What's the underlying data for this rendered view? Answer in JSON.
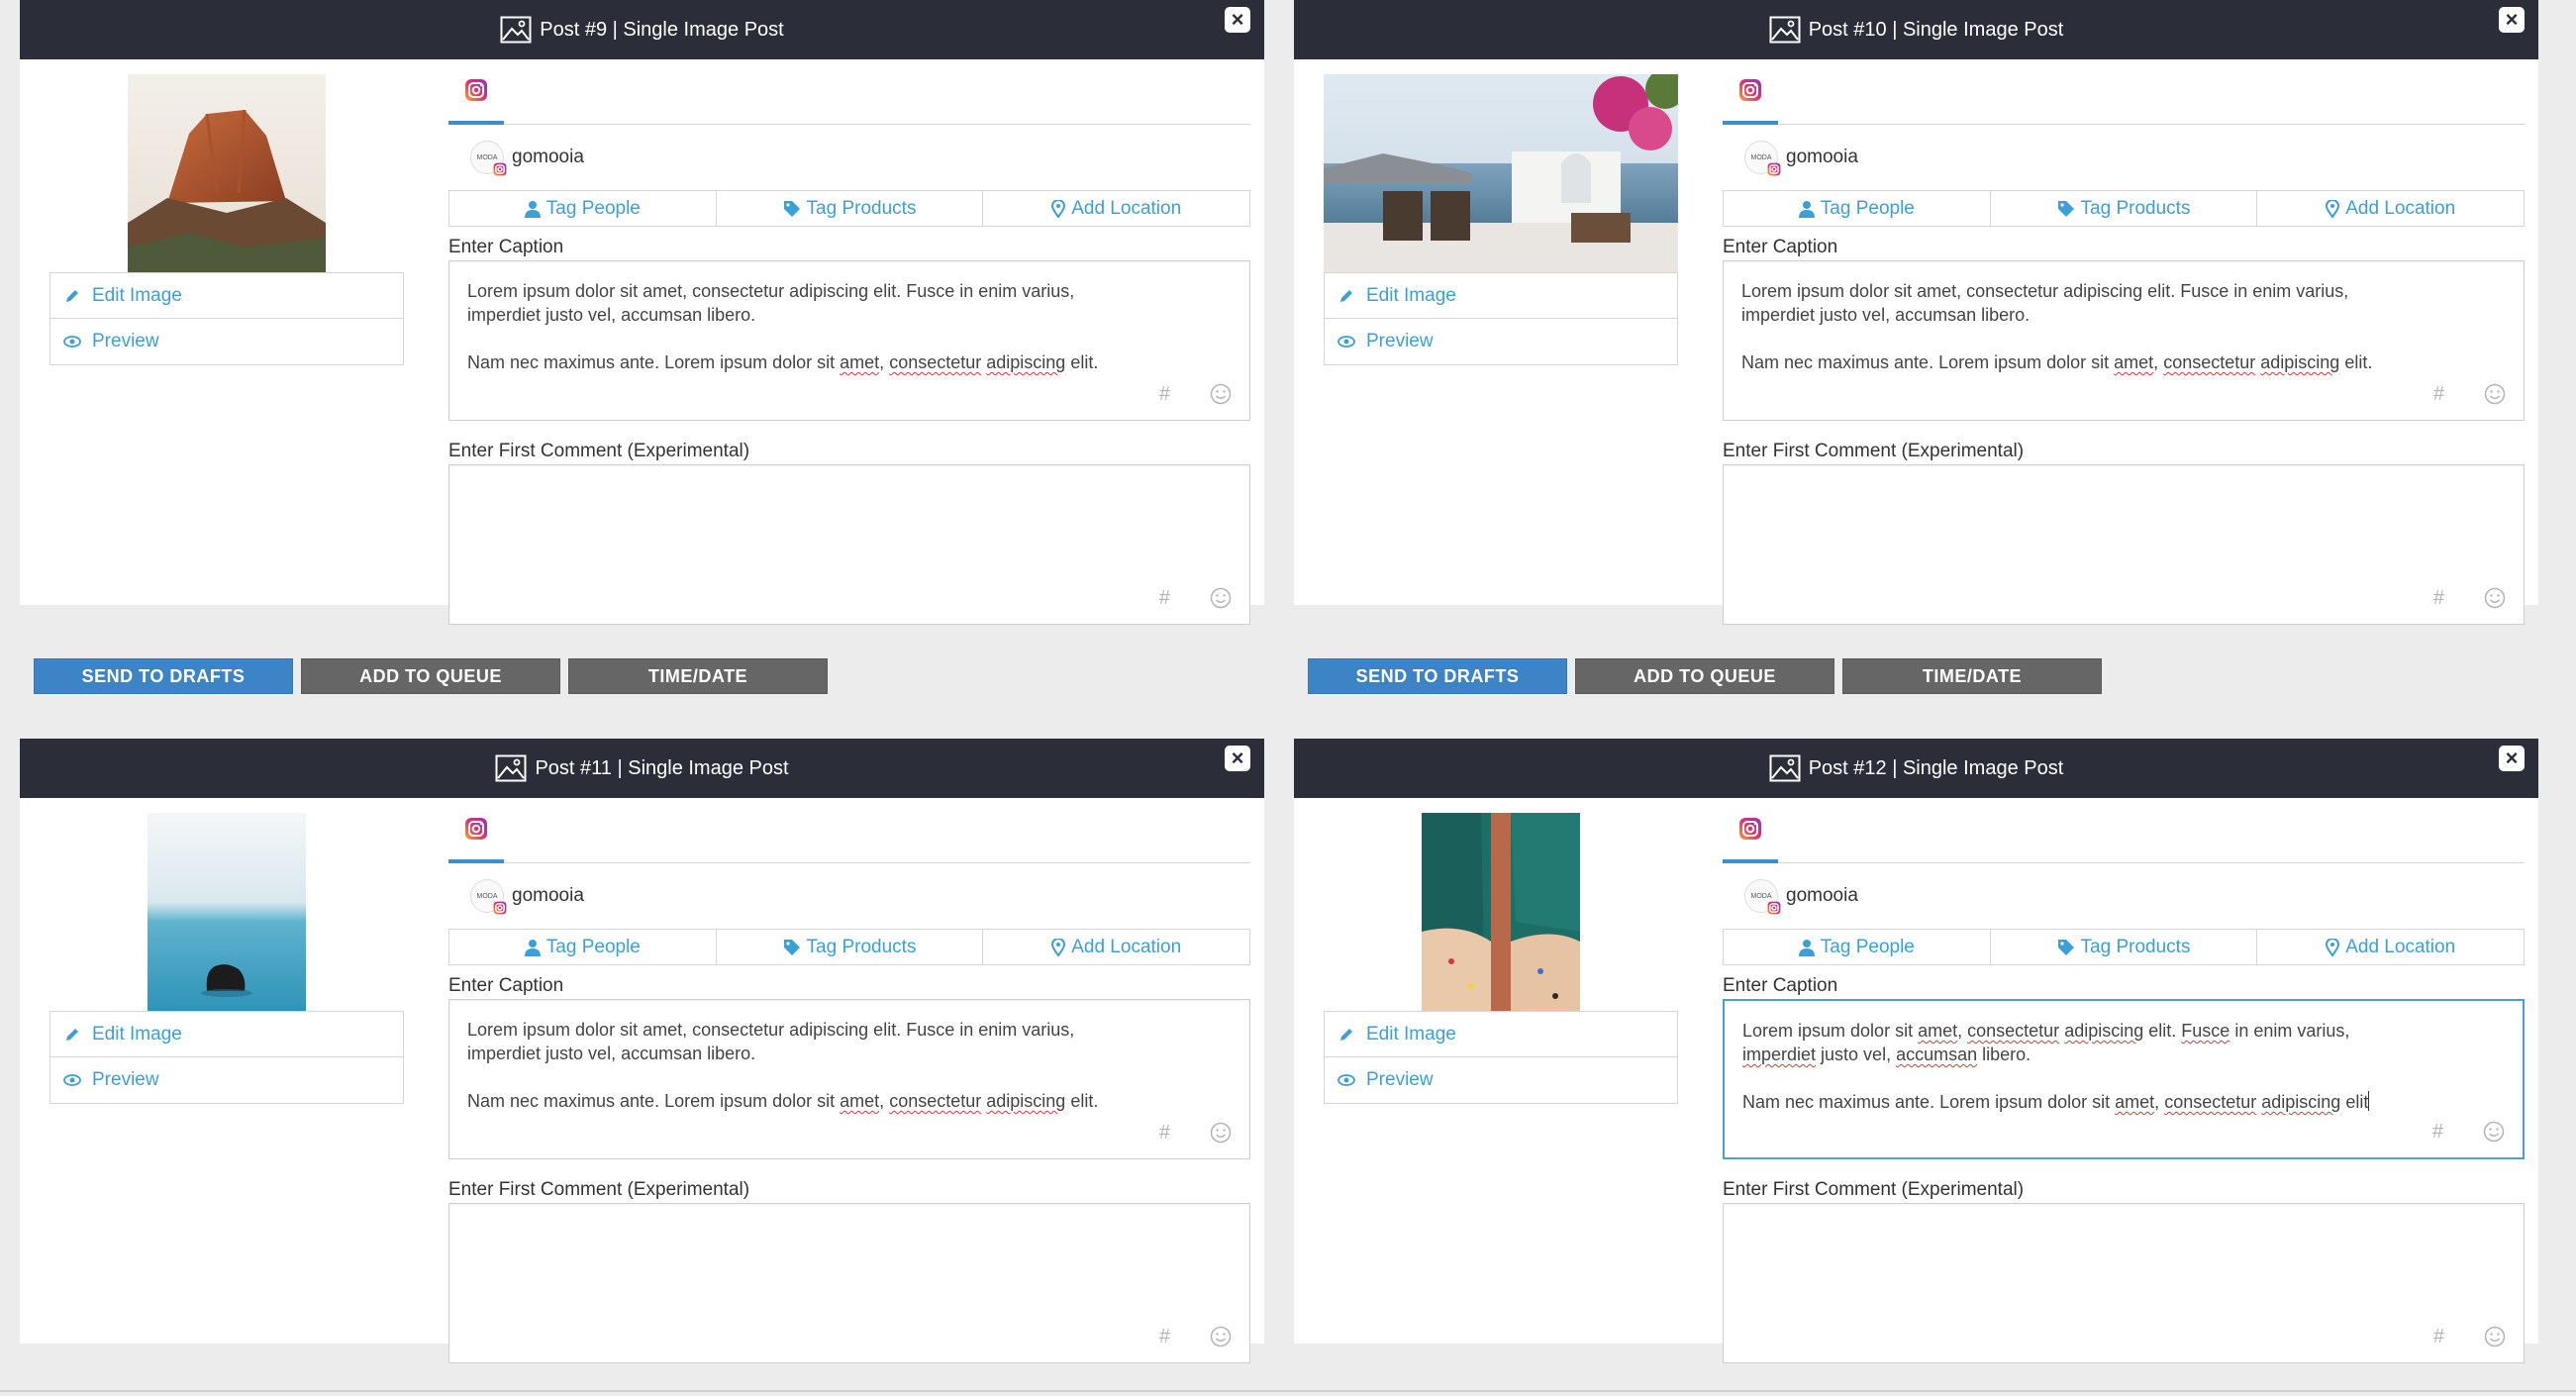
{
  "posts": [
    {
      "title": "Post #9 | Single Image Post",
      "account": "gomooia",
      "avatar_text": "MODA",
      "tags": {
        "people": "Tag People",
        "products": "Tag Products",
        "location": "Add Location"
      },
      "caption_label": "Enter Caption",
      "caption_line1": "Lorem ipsum dolor sit amet, consectetur adipiscing elit. Fusce in enim varius,",
      "caption_line2": "imperdiet justo vel, accumsan libero.",
      "caption_line3_a": "Nam nec maximus ante. Lorem ipsum dolor sit ",
      "caption_line3_b": "amet",
      "caption_line3_c": ", ",
      "caption_line3_d": "consectetur",
      "caption_line3_e": " ",
      "caption_line3_f": "adipiscing",
      "caption_line3_g": " elit.",
      "comment_label": "Enter First Comment (Experimental)",
      "edit_label": "Edit Image",
      "preview_label": "Preview",
      "hash": "#"
    },
    {
      "title": "Post #10 | Single Image Post",
      "account": "gomooia",
      "avatar_text": "MODA",
      "tags": {
        "people": "Tag People",
        "products": "Tag Products",
        "location": "Add Location"
      },
      "caption_label": "Enter Caption",
      "caption_line1": "Lorem ipsum dolor sit amet, consectetur adipiscing elit. Fusce in enim varius,",
      "caption_line2": "imperdiet justo vel, accumsan libero.",
      "caption_line3_a": "Nam nec maximus ante. Lorem ipsum dolor sit ",
      "caption_line3_b": "amet",
      "caption_line3_c": ", ",
      "caption_line3_d": "consectetur",
      "caption_line3_e": " ",
      "caption_line3_f": "adipiscing",
      "caption_line3_g": " elit.",
      "comment_label": "Enter First Comment (Experimental)",
      "edit_label": "Edit Image",
      "preview_label": "Preview",
      "hash": "#"
    },
    {
      "title": "Post #11 | Single Image Post",
      "account": "gomooia",
      "avatar_text": "MODA",
      "tags": {
        "people": "Tag People",
        "products": "Tag Products",
        "location": "Add Location"
      },
      "caption_label": "Enter Caption",
      "caption_line1": "Lorem ipsum dolor sit amet, consectetur adipiscing elit. Fusce in enim varius,",
      "caption_line2": "imperdiet justo vel, accumsan libero.",
      "caption_line3_a": "Nam nec maximus ante. Lorem ipsum dolor sit ",
      "caption_line3_b": "amet",
      "caption_line3_c": ", ",
      "caption_line3_d": "consectetur",
      "caption_line3_e": " ",
      "caption_line3_f": "adipiscing",
      "caption_line3_g": " elit.",
      "comment_label": "Enter First Comment (Experimental)",
      "edit_label": "Edit Image",
      "preview_label": "Preview",
      "hash": "#"
    },
    {
      "title": "Post #12 | Single Image Post",
      "account": "gomooia",
      "avatar_text": "MODA",
      "tags": {
        "people": "Tag People",
        "products": "Tag Products",
        "location": "Add Location"
      },
      "caption_label": "Enter Caption",
      "c12": {
        "l1_a": "Lorem ipsum dolor sit ",
        "l1_b": "amet",
        "l1_c": ", ",
        "l1_d": "consectetur",
        "l1_e": " ",
        "l1_f": "adipiscing",
        "l1_g": " elit. ",
        "l1_h": "Fusce",
        "l1_i": " in enim varius,",
        "l2_a": "imperdiet",
        "l2_b": " justo vel, ",
        "l2_c": "accumsan",
        "l2_d": " libero.",
        "l3_a": "Nam nec maximus ante. Lorem ipsum dolor sit ",
        "l3_b": "amet",
        "l3_c": ", ",
        "l3_d": "consectetur",
        "l3_e": " ",
        "l3_f": "adipiscing",
        "l3_g": " elit"
      },
      "comment_label": "Enter First Comment (Experimental)",
      "edit_label": "Edit Image",
      "preview_label": "Preview",
      "hash": "#"
    }
  ],
  "actions": {
    "drafts": "SEND TO DRAFTS",
    "queue": "ADD TO QUEUE",
    "timedate": "TIME/DATE"
  },
  "icons": {
    "header": "image-icon",
    "close": "close-icon",
    "network": "instagram-icon",
    "edit": "pencil-icon",
    "preview": "eye-icon",
    "people": "user-icon",
    "products": "tag-icon",
    "location": "map-pin-icon",
    "emoji": "smiley-icon"
  },
  "colors": {
    "header_bg": "#2b2e38",
    "link_blue": "#3aa0d6",
    "primary_button": "#3d84c6",
    "secondary_button": "#666666",
    "focus_border": "#4b9fd5"
  }
}
